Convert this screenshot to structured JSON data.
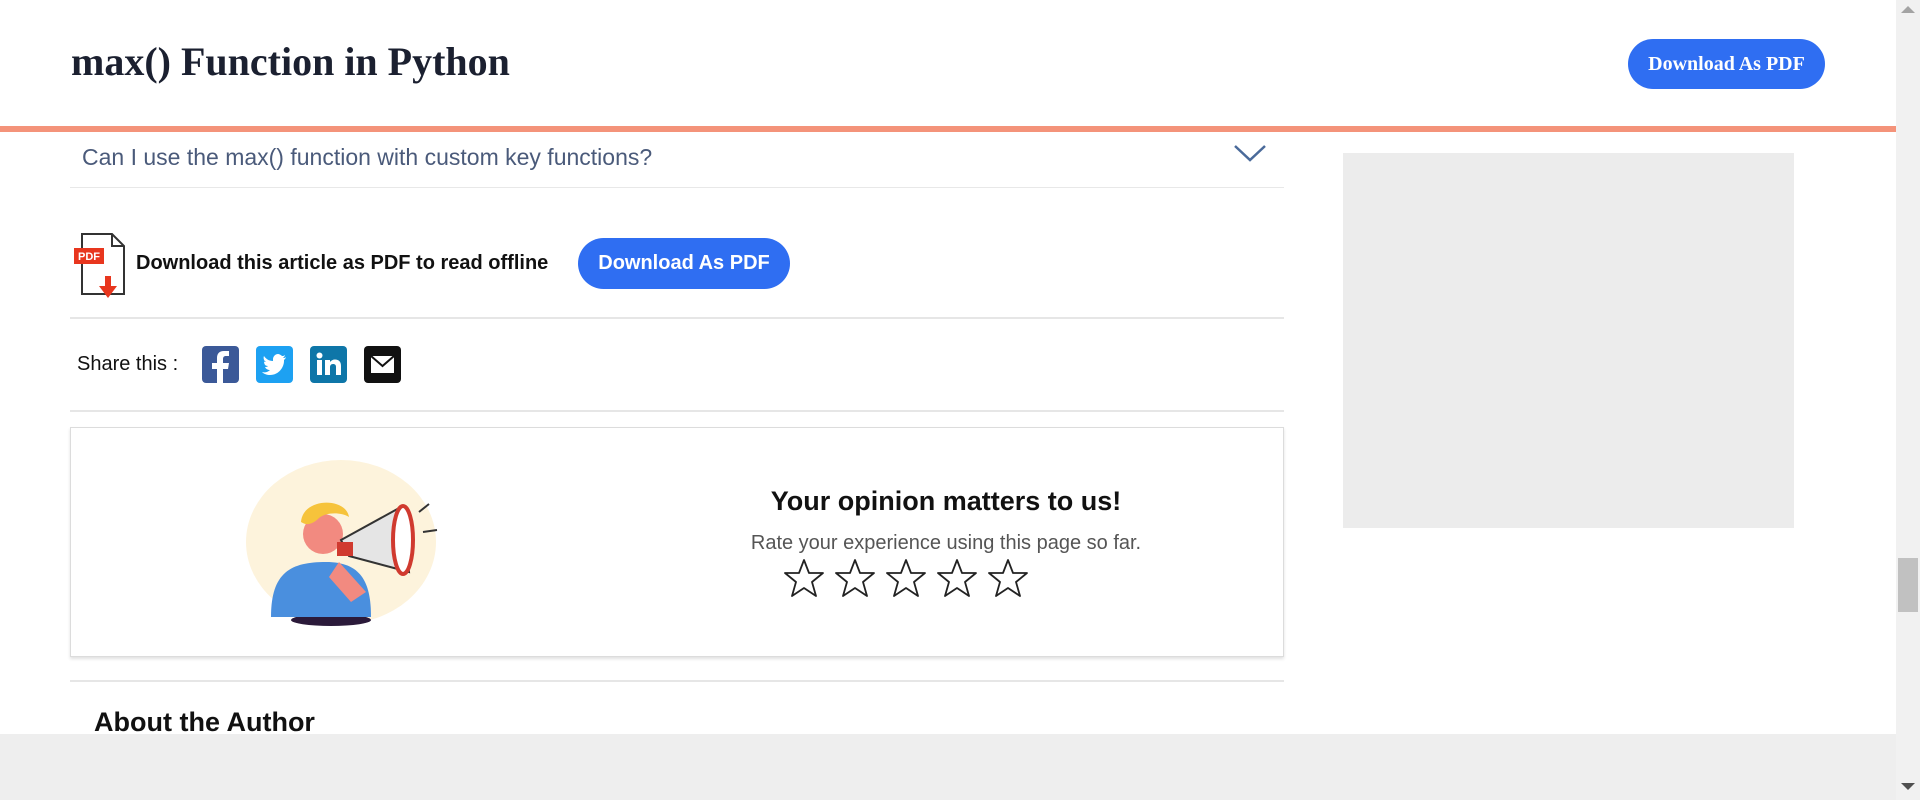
{
  "header": {
    "title": "max() Function in Python",
    "download_label": "Download As PDF"
  },
  "faq": {
    "question": "Can I use the max() function with custom key functions?"
  },
  "pdf": {
    "icon_text": "PDF",
    "text": "Download this article as PDF to read offline",
    "button_label": "Download As PDF"
  },
  "share": {
    "label": "Share this :",
    "icons": [
      "facebook-icon",
      "twitter-icon",
      "linkedin-icon",
      "email-icon"
    ]
  },
  "rating": {
    "title": "Your opinion matters to us!",
    "subtitle": "Rate your experience using this page so far.",
    "stars": 5,
    "selected": 0
  },
  "author": {
    "heading": "About the Author"
  },
  "colors": {
    "accent_blue": "#2f6ef2",
    "header_border": "#f4937a",
    "facebook": "#3b5998",
    "twitter": "#1da1f2",
    "linkedin": "#0e76a8"
  }
}
